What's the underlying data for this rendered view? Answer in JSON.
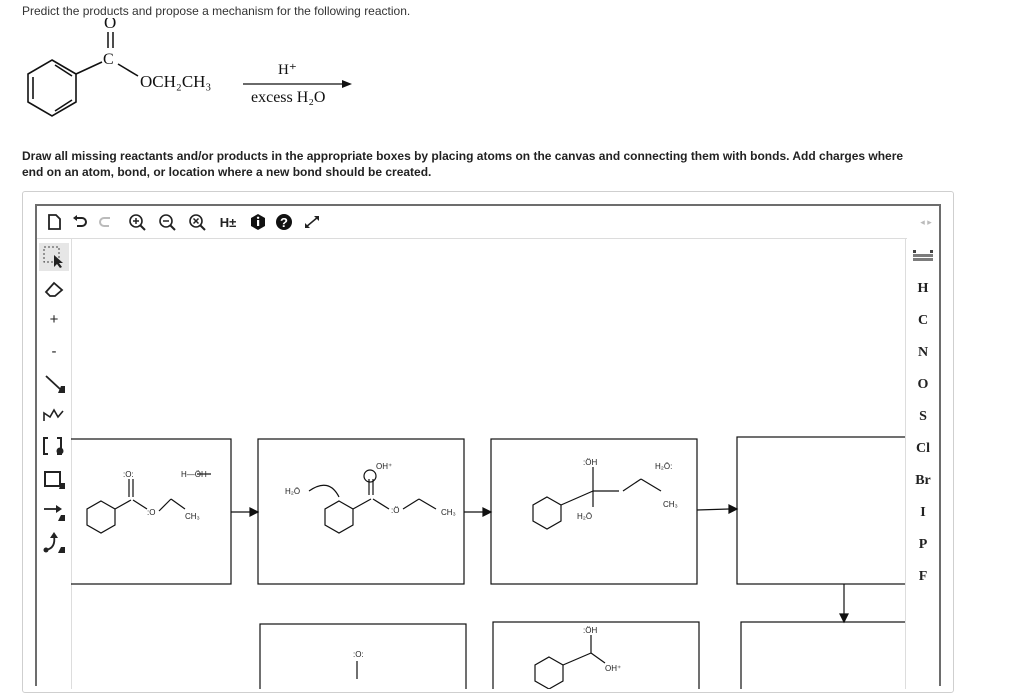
{
  "question": "Predict the products and propose a mechanism for the following reaction.",
  "scheme": {
    "carbonyl_o": "O",
    "carbonyl_c": "C",
    "ester_group": "OCH₂CH₃",
    "reagent_top": "H⁺",
    "reagent_bottom": "excess H₂O"
  },
  "instructions": {
    "line1": "Draw all missing reactants and/or products in the appropriate boxes by placing atoms on the canvas and connecting them with bonds. Add charges where",
    "line2": "end on an atom, bond, or location where a new bond should be created."
  },
  "toolbar": {
    "clear": "clear-icon",
    "undo": "undo-icon",
    "redo": "redo-icon",
    "zoom_in": "zoom-in-icon",
    "zoom_out": "zoom-out-icon",
    "zoom_reset": "zoom-reset-icon",
    "hydrogens_label": "H±",
    "info": "info-icon",
    "help": "help-icon",
    "expand": "expand-icon"
  },
  "left_tools": [
    "select",
    "erase",
    "+",
    "-",
    "single-bond",
    "chain",
    "bracket",
    "shape",
    "arrow",
    "curved-arrow"
  ],
  "atoms": [
    "H",
    "C",
    "N",
    "O",
    "S",
    "Cl",
    "Br",
    "I",
    "P",
    "F"
  ],
  "canvas_labels": {
    "box1_o_top": ":O:",
    "box1_o_ester": ":O",
    "box1_ch3": "CH₃",
    "box1_water": "H—ÖH",
    "box2_water": "H₂Ö",
    "box2_oh_plus": "OH⁺",
    "box2_o_ester": ":Ö",
    "box2_ch3": "CH₃",
    "box3_oh": ":ÖH",
    "box3_h2o_plus": "H₂Ö",
    "box3_h2o": "H₂Ö:",
    "box3_ch3": "CH₃",
    "box5_o": ":O:",
    "box6_oh": ":ÖH",
    "box6_oh_plus": "OH⁺"
  }
}
